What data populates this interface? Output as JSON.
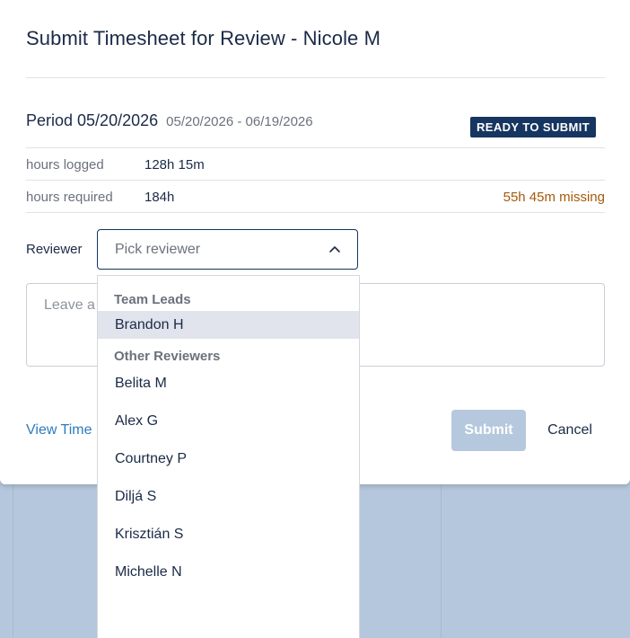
{
  "modal": {
    "title": "Submit Timesheet for Review - Nicole M",
    "period_label": "Period 05/20/2026",
    "period_range": "05/20/2026 - 06/19/2026",
    "status_badge": "READY TO SUBMIT",
    "hours_logged_label": "hours logged",
    "hours_logged_value": "128h 15m",
    "hours_required_label": "hours required",
    "hours_required_value": "184h",
    "missing_text": "55h 45m missing",
    "reviewer_label": "Reviewer",
    "reviewer_placeholder": "Pick reviewer",
    "comment_placeholder": "Leave a",
    "view_link": "View Time",
    "submit_label": "Submit",
    "cancel_label": "Cancel"
  },
  "dropdown": {
    "group1_label": "Team Leads",
    "group1_options": [
      "Brandon H"
    ],
    "group2_label": "Other Reviewers",
    "group2_options": [
      "Belita M",
      "Alex G",
      "Courtney P",
      "Diljá S",
      "Krisztián S",
      "Michelle N"
    ]
  },
  "colors": {
    "primary": "#163560",
    "link": "#2c7bbf",
    "warning": "#a4590a",
    "disabled_button": "#b6c8dd",
    "highlight": "#e1e4ec"
  },
  "icons": {
    "select_toggle": "chevron-up-icon"
  }
}
